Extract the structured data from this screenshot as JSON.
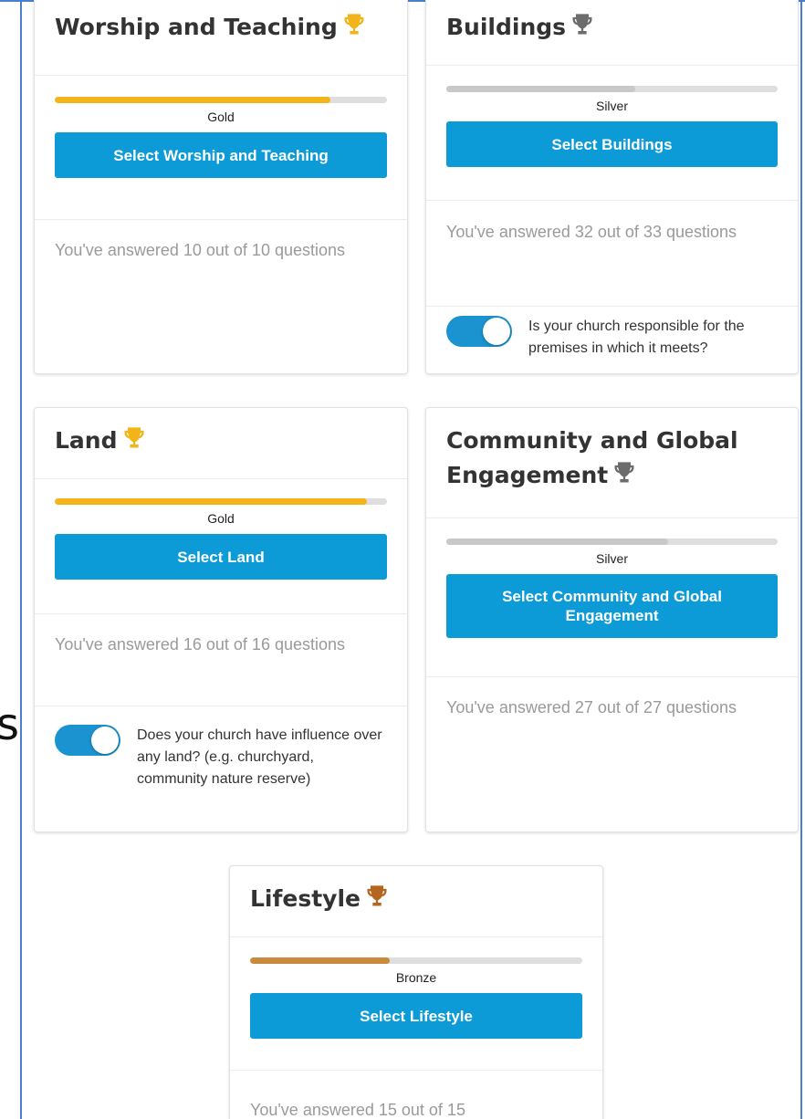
{
  "cards": [
    {
      "title": "Worship and Teaching",
      "trophy": "trophy-icon",
      "trophy_color": "#f2b418",
      "level": "Gold",
      "progress": 0.83,
      "fill_color": "#f2b418",
      "button": "Select Worship and Teaching",
      "answered": "You've answered 10 out of 10 questions"
    },
    {
      "title": "Buildings",
      "trophy": "trophy-icon",
      "trophy_color": "#6c6c6c",
      "level": "Silver",
      "progress": 0.57,
      "fill_color": "#c8c8c8",
      "button": "Select Buildings",
      "answered": "You've answered 32 out of 33 questions",
      "toggle": {
        "on": true,
        "label": "Is your church responsible for the premises in which it meets?"
      }
    },
    {
      "title": "Land",
      "trophy": "trophy-icon",
      "trophy_color": "#f2b418",
      "level": "Gold",
      "progress": 0.94,
      "fill_color": "#f2b418",
      "button": "Select Land",
      "answered": "You've answered 16 out of 16 questions",
      "toggle": {
        "on": true,
        "label": "Does your church have influence over any land? (e.g. churchyard, community nature reserve)"
      }
    },
    {
      "title": "Community and Global Engagement",
      "trophy": "trophy-icon",
      "trophy_color": "#6c6c6c",
      "level": "Silver",
      "progress": 0.67,
      "fill_color": "#c8c8c8",
      "button": "Select Community and Global Engagement",
      "answered": "You've answered 27 out of 27 questions"
    },
    {
      "title": "Lifestyle",
      "trophy": "trophy-icon",
      "trophy_color": "#b5651d",
      "level": "Bronze",
      "progress": 0.42,
      "fill_color": "#c98a3e",
      "button": "Select Lifestyle",
      "answered": "You've answered 15 out of 15"
    }
  ],
  "stray_text": "s"
}
